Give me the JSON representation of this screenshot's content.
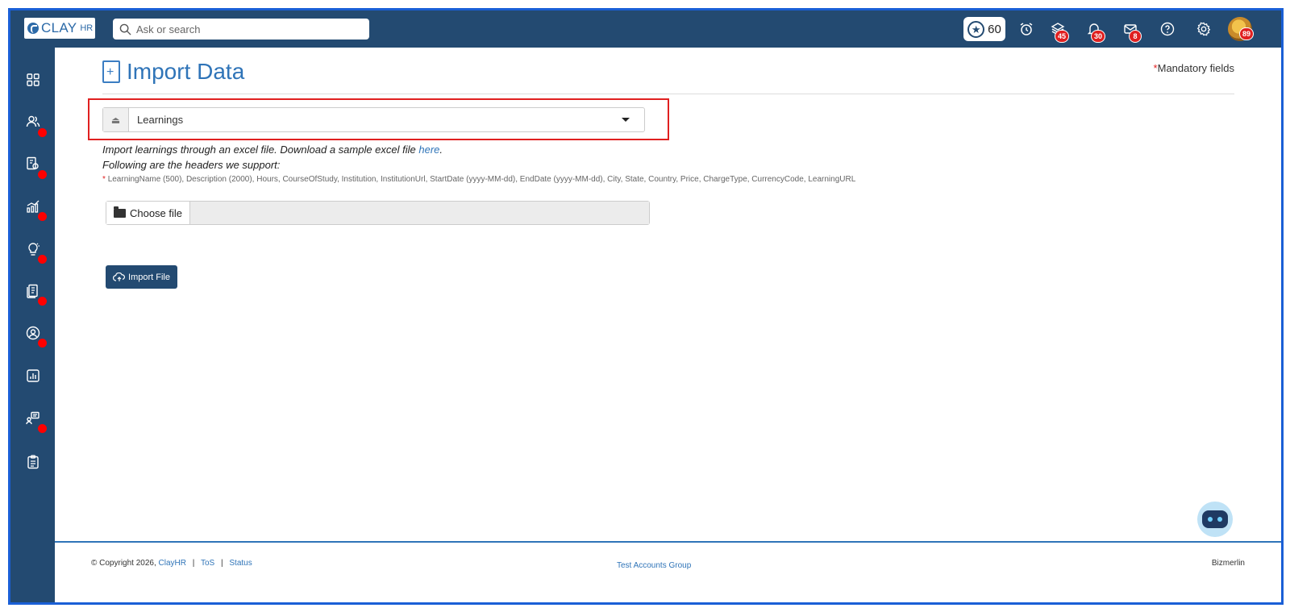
{
  "brand": {
    "logo_text": "CLAY",
    "logo_suffix": "HR"
  },
  "search": {
    "placeholder": "Ask or search"
  },
  "topbar": {
    "points": "60",
    "badges": {
      "layers": "45",
      "notifications": "30",
      "messages": "8",
      "profile": "89"
    }
  },
  "page": {
    "title": "Import Data",
    "mandatory_marker": "*",
    "mandatory_label": "Mandatory fields",
    "select_value": "Learnings",
    "info_line1_prefix": "Import learnings through an excel file. Download a sample excel file ",
    "info_line1_link": "here",
    "info_line1_suffix": ".",
    "info_line2": "Following are the headers we support:",
    "headers_marker": "*",
    "headers_list": "LearningName (500), Description (2000), Hours, CourseOfStudy, Institution, InstitutionUrl, StartDate (yyyy-MM-dd), EndDate (yyyy-MM-dd), City, State, Country, Price, ChargeType, CurrencyCode, LearningURL",
    "choose_file_label": "Choose file",
    "import_button": "Import File"
  },
  "footer": {
    "copyright": "© Copyright 2026,",
    "company_link": "ClayHR",
    "tos": "ToS",
    "status": "Status",
    "separator": "|",
    "group": "Test Accounts Group",
    "right_text": "Bizmerlin"
  },
  "colors": {
    "topbar": "#234a71",
    "accent": "#2f74b8",
    "alert": "#e02020"
  }
}
